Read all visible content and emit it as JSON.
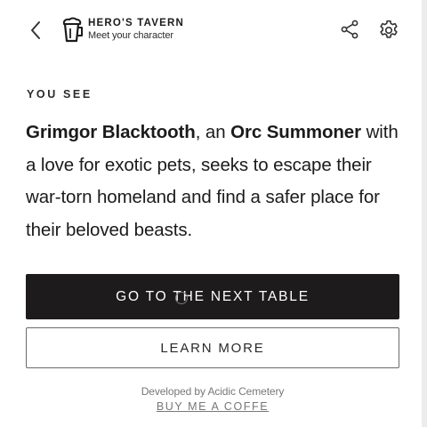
{
  "header": {
    "back_icon": "chevron-left-icon",
    "logo_icon": "beer-mug-icon",
    "title": "HERO'S TAVERN",
    "subtitle": "Meet your character",
    "share_icon": "share-icon",
    "settings_icon": "gear-icon"
  },
  "content": {
    "eyebrow": "YOU SEE",
    "character_name": "Grimgor Blacktooth",
    "joiner": ", an ",
    "character_class": "Orc Summoner",
    "description_rest": " with a love for exotic pets, seeks to escape their war-torn homeland and find a safer place for their beloved beasts."
  },
  "actions": {
    "primary_label": "GO TO THE NEXT TABLE",
    "secondary_label": "LEARN MORE"
  },
  "footer": {
    "developer_text": "Developed by Acidic Cemetery",
    "coffee_link": "BUY ME A COFFE"
  },
  "colors": {
    "primary_button_bg": "#1d1b1c",
    "text": "#1b1b1b",
    "muted": "#777777"
  }
}
